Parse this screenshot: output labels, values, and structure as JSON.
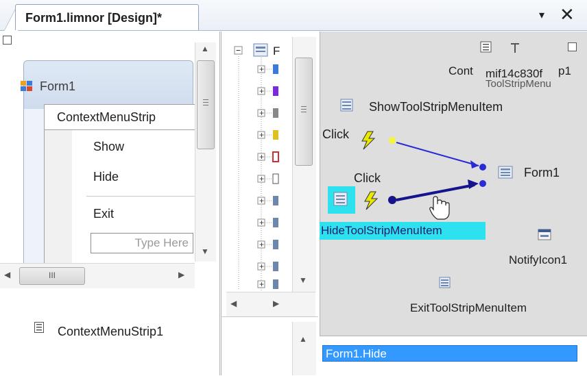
{
  "tab": {
    "title": "Form1.limnor [Design]*"
  },
  "window_controls": {
    "dropdown": "▾",
    "close": "✕"
  },
  "form": {
    "title": "Form1",
    "menu_header": "ContextMenuStrip",
    "menu_items": [
      "Show",
      "Hide",
      "Exit"
    ],
    "type_here": "Type Here",
    "hscroll_grip": "III"
  },
  "components": {
    "context_menu": "ContextMenuStrip1"
  },
  "canvas": {
    "show_item": "ShowToolStripMenuItem",
    "hide_item": "HideToolStripMenuItem",
    "exit_item": "ExitToolStripMenuItem",
    "form_node": "Form1",
    "click_label_1": "Click",
    "click_label_2": "Click",
    "notify_icon": "NotifyIcon1",
    "overlap_text_1": "Cont",
    "overlap_text_2": "mif14c830f",
    "overlap_text_3": "p1",
    "overlap_text_4": "ToolStripMenu"
  },
  "output": {
    "selected": "Form1.Hide"
  },
  "colors": {
    "highlight": "#2ee1ee",
    "selection": "#3399ff",
    "link_dark": "#14148c",
    "link_light": "#2a2ad6",
    "port_yellow": "#f5f53a"
  }
}
